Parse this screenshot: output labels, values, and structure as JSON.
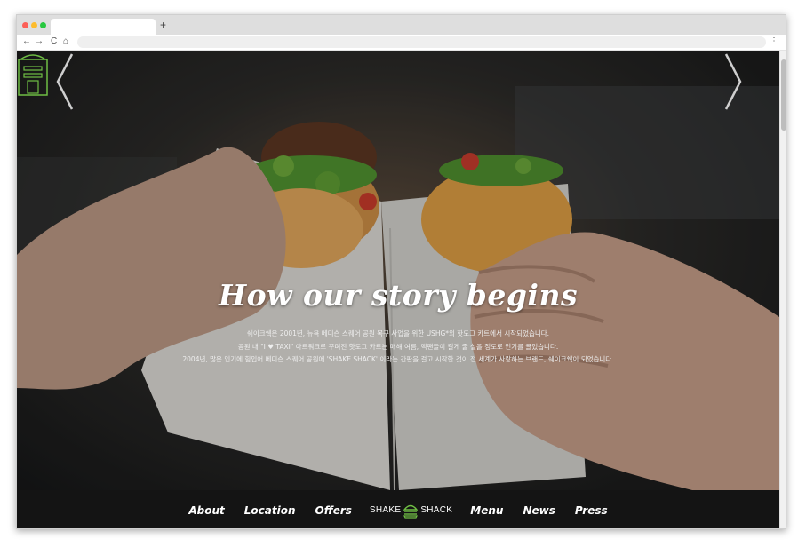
{
  "browser": {
    "new_tab_label": "+",
    "back_icon": "←",
    "forward_icon": "→",
    "reload_icon": "C",
    "home_icon": "⌂",
    "menu_icon": "⋮",
    "address": ""
  },
  "hero": {
    "title": "How our story begins",
    "lines": [
      "쉐이크쉑은 2001년, 뉴욕 메디슨 스퀘어 공원 복구 사업을 위한 USHG*의 핫도그 카트에서 시작되었습니다.",
      "공원 내 \"I ♥ TAXI\" 아트워크로 꾸며진 핫도그 카트는 매해 여름, 맥팬들이 길게 줄 설을 정도로 인기를 끌었습니다.",
      "2004년, 많은 인기에 힘입어 메디슨 스퀘어 공원에 'SHAKE SHACK' 이라는 간판을 걸고 시작한 것이 전 세계가 사랑하는 브랜드, 쉐이크쉑이 되었습니다."
    ]
  },
  "nav": {
    "about": "About",
    "location": "Location",
    "offers": "Offers",
    "logo_left": "SHAKE",
    "logo_right": "SHACK",
    "menu": "Menu",
    "news": "News",
    "press": "Press"
  },
  "colors": {
    "brand_green": "#6fbe44",
    "footer_bg": "#141414"
  }
}
